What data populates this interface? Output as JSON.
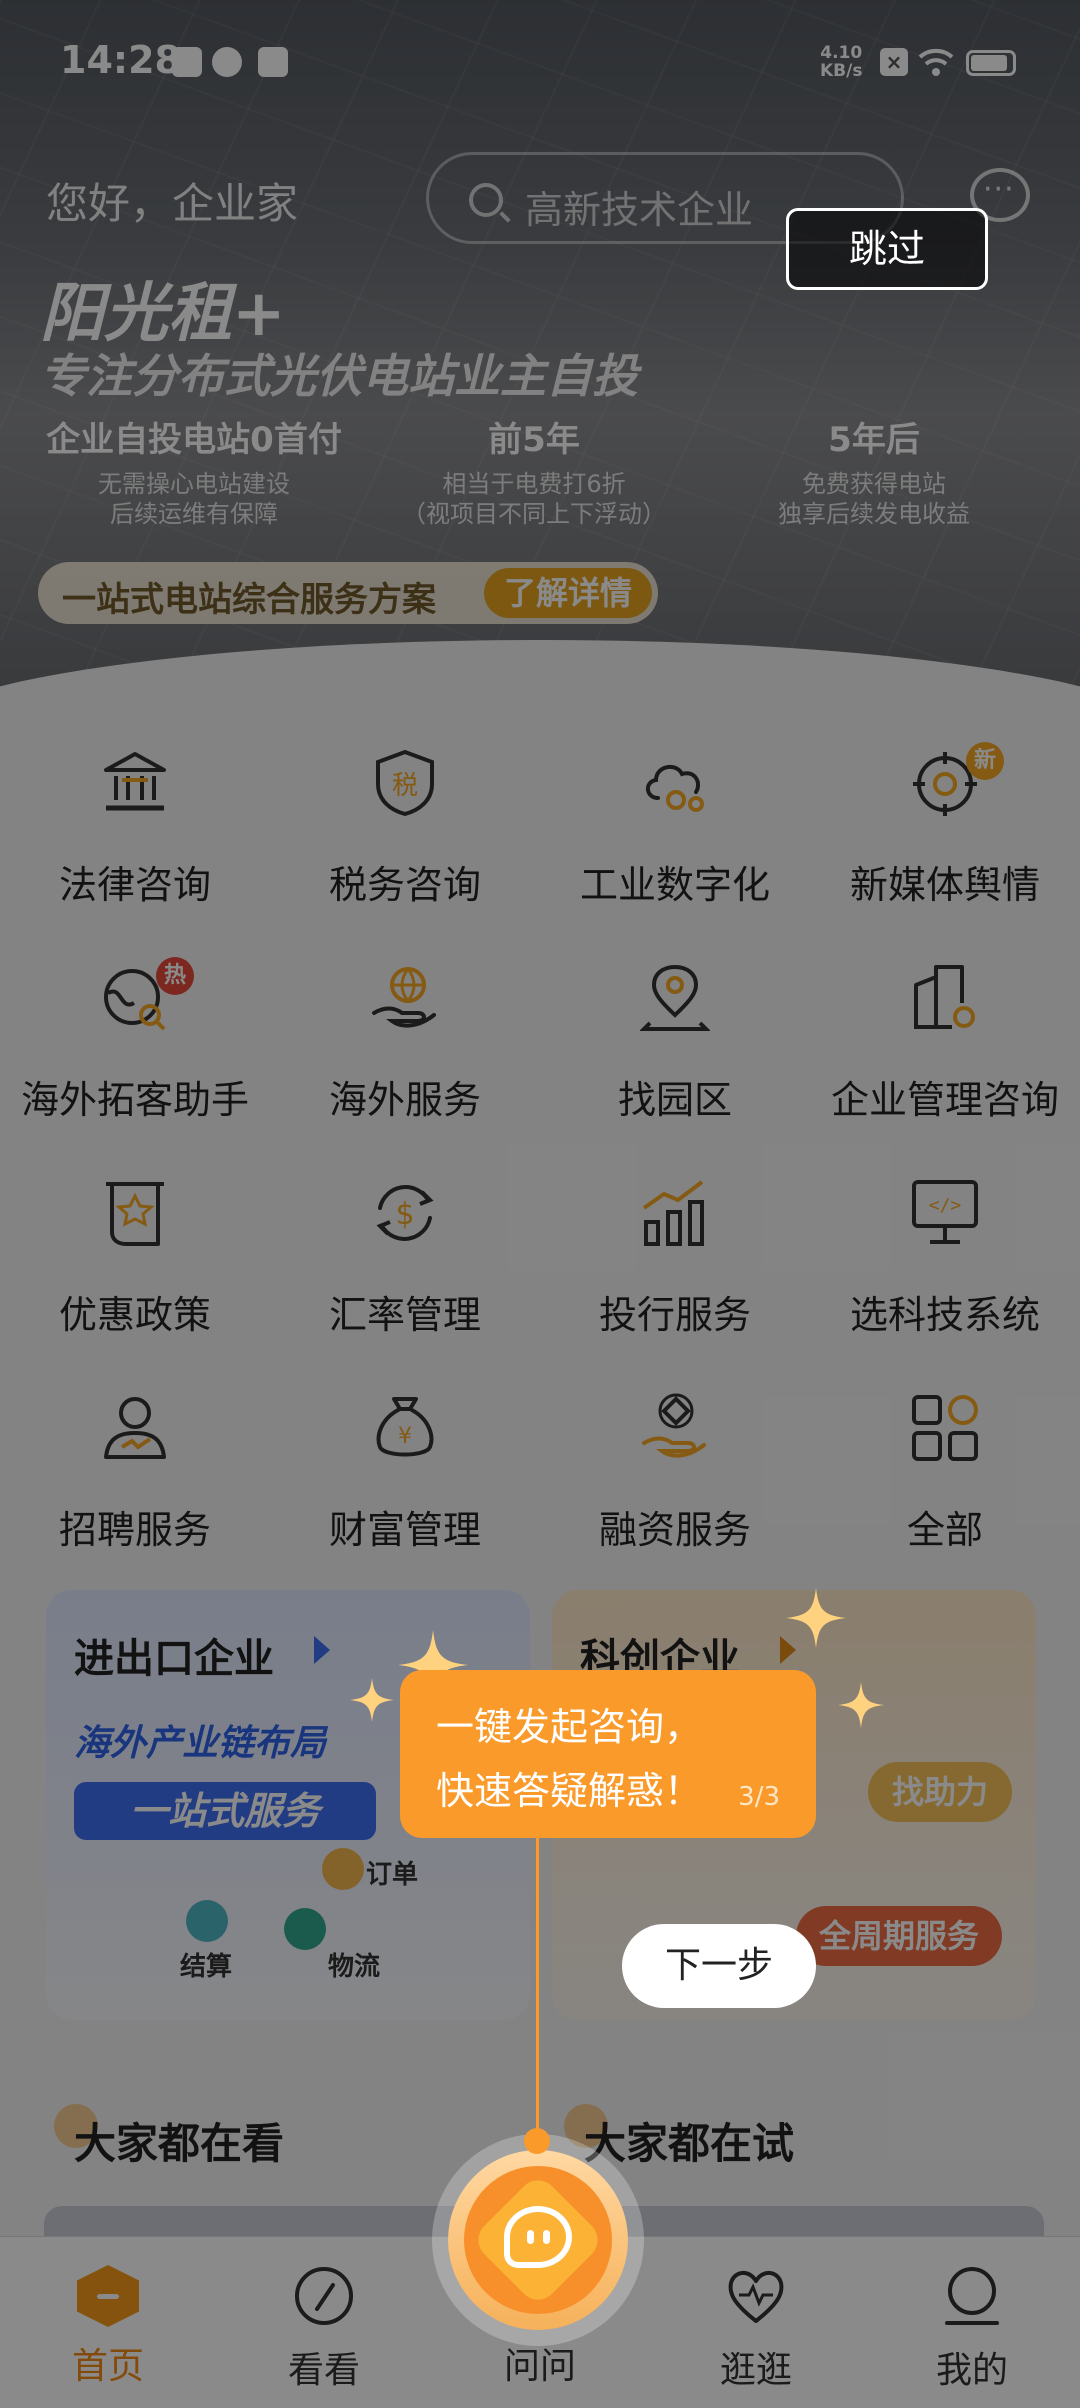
{
  "status_bar": {
    "time": "14:28",
    "net_speed": "4.10",
    "net_unit": "KB/s",
    "x_badge": "×"
  },
  "header": {
    "greeting": "您好，企业家",
    "search_placeholder": "高新技术企业"
  },
  "banner": {
    "title": "阳光租+",
    "subtitle": "专注分布式光伏电站业主自投",
    "features": [
      {
        "head": "企业自投电站0首付",
        "line1": "无需操心电站建设",
        "line2": "后续运维有保障"
      },
      {
        "head": "前5年",
        "line1": "相当于电费打6折",
        "line2": "（视项目不同上下浮动）"
      },
      {
        "head": "5年后",
        "line1": "免费获得电站",
        "line2": "独享后续发电收益"
      }
    ],
    "pill_text": "一站式电站综合服务方案",
    "pill_button": "了解详情"
  },
  "services": [
    {
      "label": "法律咨询",
      "icon": "court-icon"
    },
    {
      "label": "税务咨询",
      "icon": "tax-shield-icon",
      "glyph": "税"
    },
    {
      "label": "工业数字化",
      "icon": "cloud-gear-icon"
    },
    {
      "label": "新媒体舆情",
      "icon": "target-icon",
      "badge": "新"
    },
    {
      "label": "海外拓客助手",
      "icon": "globe-search-icon",
      "badge": "热"
    },
    {
      "label": "海外服务",
      "icon": "globe-hand-icon"
    },
    {
      "label": "找园区",
      "icon": "map-pin-icon"
    },
    {
      "label": "企业管理咨询",
      "icon": "building-gear-icon"
    },
    {
      "label": "优惠政策",
      "icon": "policy-scroll-icon"
    },
    {
      "label": "汇率管理",
      "icon": "currency-exchange-icon",
      "glyph": "$"
    },
    {
      "label": "投行服务",
      "icon": "bar-chart-icon"
    },
    {
      "label": "选科技系统",
      "icon": "monitor-code-icon",
      "glyph": "</>"
    },
    {
      "label": "招聘服务",
      "icon": "person-icon"
    },
    {
      "label": "财富管理",
      "icon": "money-bag-icon",
      "glyph": "¥"
    },
    {
      "label": "融资服务",
      "icon": "coin-hand-icon"
    },
    {
      "label": "全部",
      "icon": "all-grid-icon"
    }
  ],
  "cards": {
    "left": {
      "title": "进出口企业",
      "line": "海外产业链布局",
      "stamp": "一站式服务",
      "tags": [
        "订单",
        "结算",
        "物流"
      ]
    },
    "right": {
      "title": "科创企业",
      "tag1": "找助力",
      "tag2": "全周期服务"
    }
  },
  "sections": {
    "left": "大家都在看",
    "right": "大家都在试"
  },
  "tabs": [
    "首页",
    "看看",
    "问问",
    "逛逛",
    "我的"
  ],
  "guide": {
    "skip": "跳过",
    "line1": "一键发起咨询，",
    "line2": "快速答疑解惑！",
    "step": "3/3",
    "next": "下一步"
  },
  "colors": {
    "accent": "#f99a2b",
    "primary_blue": "#3d6ff2",
    "tab_active": "#f08a16"
  }
}
